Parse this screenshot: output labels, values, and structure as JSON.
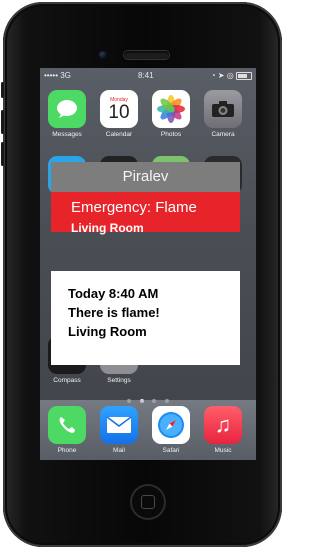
{
  "status_bar": {
    "carrier": "••••• 3G",
    "time": "8:41",
    "right_icons": "◔ ➤ ◎"
  },
  "home_screen": {
    "row1": [
      {
        "label": "Messages",
        "icon": "messages-icon",
        "color": "#4cd964"
      },
      {
        "label": "Calendar",
        "icon": "calendar-icon",
        "color": "#ffffff",
        "day": "Monday",
        "date": "10"
      },
      {
        "label": "Photos",
        "icon": "photos-icon",
        "color": "#ffffff"
      },
      {
        "label": "Camera",
        "icon": "camera-icon",
        "color": "#8e8e93"
      }
    ],
    "compass_label": "Compass",
    "settings_label": "Settings",
    "dock": [
      {
        "label": "Phone",
        "icon": "phone-icon",
        "color": "#4cd964"
      },
      {
        "label": "Mail",
        "icon": "mail-icon",
        "color": "#1e90ff"
      },
      {
        "label": "Safari",
        "icon": "safari-icon",
        "color": "#ffffff"
      },
      {
        "label": "Music",
        "icon": "music-icon",
        "color": "#ff2d55"
      }
    ]
  },
  "alert": {
    "app_name": "Piralev",
    "title": "Emergency: Flame",
    "location": "Living Room",
    "time_line": "Today 8:40 AM",
    "message": "There is flame!",
    "message_location": "Living Room",
    "accent_color": "#e8242b"
  }
}
